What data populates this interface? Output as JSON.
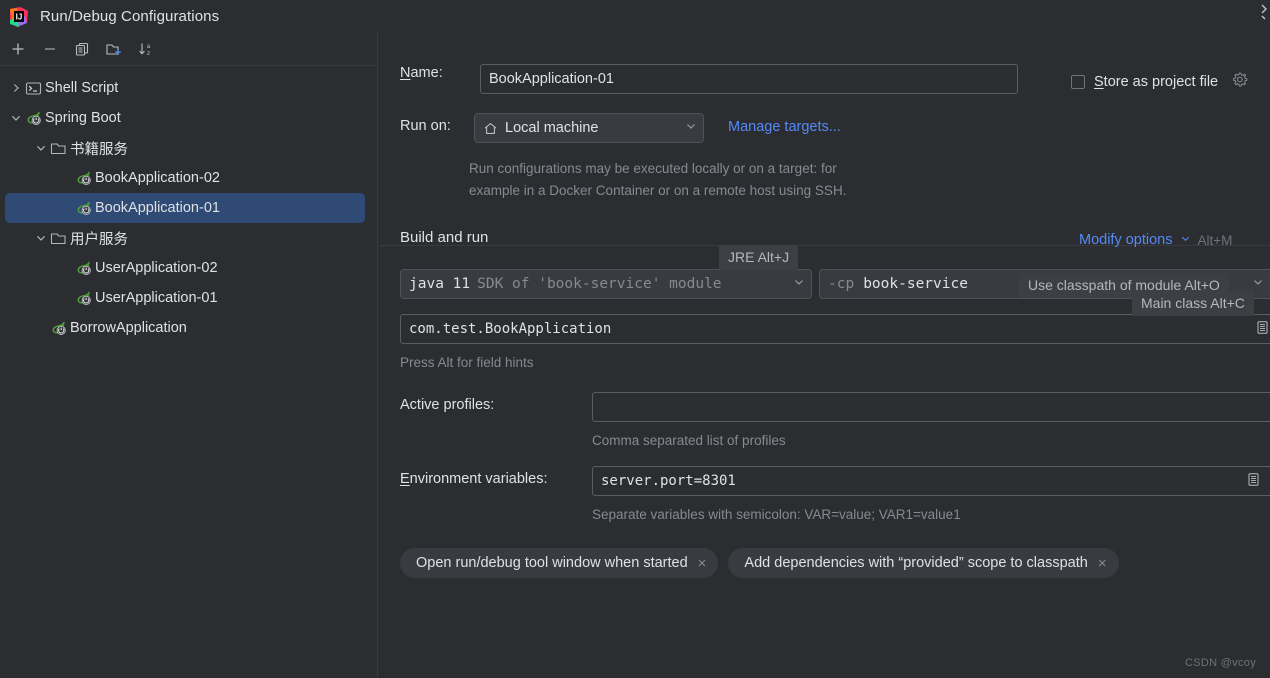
{
  "window": {
    "title": "Run/Debug Configurations",
    "app_icon": "intellij-idea-logo"
  },
  "left_panel": {
    "toolbar": [
      {
        "name": "add-configuration-button",
        "icon": "plus-icon",
        "label": "+"
      },
      {
        "name": "remove-configuration-button",
        "icon": "minus-icon",
        "label": "−"
      },
      {
        "name": "copy-configuration-button",
        "icon": "copy-icon",
        "label": ""
      },
      {
        "name": "new-folder-button",
        "icon": "new-folder-icon",
        "label": ""
      },
      {
        "name": "sort-configurations-button",
        "icon": "sort-alphabetical-icon",
        "label": ""
      }
    ],
    "tree": [
      {
        "label": "Shell Script",
        "icon": "shell-script-icon",
        "indent": 0,
        "arrow": "collapsed",
        "selected": false
      },
      {
        "label": "Spring Boot",
        "icon": "spring-boot-icon",
        "indent": 0,
        "arrow": "expanded",
        "selected": false
      },
      {
        "label": "书籍服务",
        "icon": "folder-icon",
        "indent": 1,
        "arrow": "expanded",
        "selected": false
      },
      {
        "label": "BookApplication-02",
        "icon": "spring-boot-icon",
        "indent": 2,
        "arrow": "none",
        "selected": false
      },
      {
        "label": "BookApplication-01",
        "icon": "spring-boot-icon",
        "indent": 2,
        "arrow": "none",
        "selected": true
      },
      {
        "label": "用户服务",
        "icon": "folder-icon",
        "indent": 1,
        "arrow": "expanded",
        "selected": false
      },
      {
        "label": "UserApplication-02",
        "icon": "spring-boot-icon",
        "indent": 2,
        "arrow": "none",
        "selected": false
      },
      {
        "label": "UserApplication-01",
        "icon": "spring-boot-icon",
        "indent": 2,
        "arrow": "none",
        "selected": false
      },
      {
        "label": "BorrowApplication",
        "icon": "spring-boot-icon",
        "indent": 1,
        "arrow": "none",
        "selected": false
      }
    ]
  },
  "form": {
    "name_label": "Name:",
    "name_label_mnemonic": "N",
    "name_value": "BookApplication-01",
    "store_as_project_file_label": "Store as project file",
    "store_as_project_file_mnemonic": "S",
    "store_as_project_file_checked": false,
    "run_on_label": "Run on:",
    "run_on_value": "Local machine",
    "run_on_icon": "home-icon",
    "manage_targets_link": "Manage targets...",
    "run_on_description_line1": "Run configurations may be executed locally or on a target: for",
    "run_on_description_line2": "example in a Docker Container or on a remote host using SSH.",
    "build_and_run_title": "Build and run",
    "modify_options_label": "Modify options",
    "modify_options_shortcut": "Alt+M",
    "jre_value_bold": "java 11",
    "jre_value_dim": "SDK of 'book-service' module",
    "classpath_prefix": "-cp",
    "classpath_value": "book-service",
    "main_class_value": "com.test.BookApplication",
    "field_hints_text": "Press Alt for field hints",
    "active_profiles_label": "Active profiles:",
    "active_profiles_value": "",
    "active_profiles_hint": "Comma separated list of profiles",
    "env_vars_label": "Environment variables:",
    "env_vars_label_mnemonic": "E",
    "env_vars_value": "server.port=8301",
    "env_vars_hint": "Separate variables with semicolon: VAR=value; VAR1=value1",
    "chips": [
      {
        "label": "Open run/debug tool window when started",
        "close": "×"
      },
      {
        "label": "Add dependencies with “provided” scope to classpath",
        "close": "×"
      }
    ]
  },
  "tooltips": [
    {
      "name": "jre-tooltip",
      "text": "JRE Alt+J"
    },
    {
      "name": "classpath-tooltip",
      "text": "Use classpath of module Alt+O"
    },
    {
      "name": "main-class-tooltip",
      "text": "Main class Alt+C"
    }
  ],
  "watermark": "CSDN @vcoy",
  "colors": {
    "background": "#2b2d30",
    "selection": "#2f4a74",
    "link": "#548af7",
    "hint_text": "#868a91",
    "spring_green": "#4d9b3a",
    "border": "#393b40"
  }
}
